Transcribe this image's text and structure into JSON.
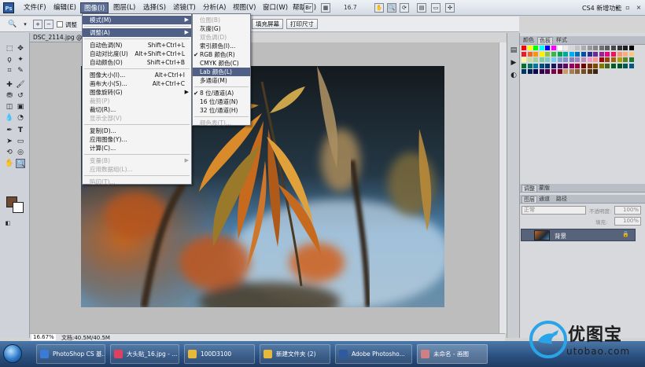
{
  "app": {
    "logo": "Ps",
    "zoom": "16.7",
    "workspace": "CS4 新增功能"
  },
  "menubar": [
    "文件(F)",
    "编辑(E)",
    "图像(I)",
    "图层(L)",
    "选择(S)",
    "滤镜(T)",
    "分析(A)",
    "视图(V)",
    "窗口(W)",
    "帮助(H)"
  ],
  "options_bar": {
    "resize_label": "调整",
    "print_size": "打印尺寸",
    "fill_screen": "填充屏幕"
  },
  "document": {
    "tab_title": "DSC_2114.jpg @",
    "zoom_percent": "16.67%",
    "doc_size": "文档:40.5M/40.5M"
  },
  "image_menu": [
    {
      "label": "模式(M)",
      "shortcut": "",
      "submenu": true,
      "disabled": false,
      "highlight": true
    },
    {
      "sep": true
    },
    {
      "label": "调整(A)",
      "shortcut": "",
      "submenu": true,
      "disabled": false,
      "highlight": false,
      "sub_hl": true
    },
    {
      "sep": true
    },
    {
      "label": "自动色调(N)",
      "shortcut": "Shift+Ctrl+L",
      "disabled": false
    },
    {
      "label": "自动对比度(U)",
      "shortcut": "Alt+Shift+Ctrl+L",
      "disabled": false
    },
    {
      "label": "自动颜色(O)",
      "shortcut": "Shift+Ctrl+B",
      "disabled": false
    },
    {
      "sep": true
    },
    {
      "label": "图像大小(I)...",
      "shortcut": "Alt+Ctrl+I",
      "disabled": false
    },
    {
      "label": "画布大小(S)...",
      "shortcut": "Alt+Ctrl+C",
      "disabled": false
    },
    {
      "label": "图像旋转(G)",
      "shortcut": "",
      "submenu": true,
      "disabled": false
    },
    {
      "label": "裁剪(P)",
      "shortcut": "",
      "disabled": true
    },
    {
      "label": "裁切(R)...",
      "shortcut": "",
      "disabled": false
    },
    {
      "label": "显示全部(V)",
      "shortcut": "",
      "disabled": true
    },
    {
      "sep": true
    },
    {
      "label": "复制(D)...",
      "shortcut": "",
      "disabled": false
    },
    {
      "label": "应用图像(Y)...",
      "shortcut": "",
      "disabled": false
    },
    {
      "label": "计算(C)...",
      "shortcut": "",
      "disabled": false
    },
    {
      "sep": true
    },
    {
      "label": "变量(B)",
      "shortcut": "",
      "submenu": true,
      "disabled": true
    },
    {
      "label": "应用数据组(L)...",
      "shortcut": "",
      "disabled": true
    },
    {
      "sep": true
    },
    {
      "label": "陷印(T)...",
      "shortcut": "",
      "disabled": true
    }
  ],
  "mode_menu": [
    {
      "label": "位图(B)",
      "disabled": true,
      "checked": false
    },
    {
      "label": "灰度(G)",
      "disabled": false,
      "checked": false
    },
    {
      "label": "双色调(D)",
      "disabled": true,
      "checked": false
    },
    {
      "label": "索引颜色(I)...",
      "disabled": false,
      "checked": false
    },
    {
      "label": "RGB 颜色(R)",
      "disabled": false,
      "checked": true
    },
    {
      "label": "CMYK 颜色(C)",
      "disabled": false,
      "checked": false
    },
    {
      "label": "Lab 颜色(L)",
      "disabled": false,
      "checked": false,
      "highlight": true
    },
    {
      "label": "多通道(M)",
      "disabled": false,
      "checked": false
    },
    {
      "sep": true
    },
    {
      "label": "8 位/通道(A)",
      "disabled": false,
      "checked": true
    },
    {
      "label": "16 位/通道(N)",
      "disabled": false,
      "checked": false
    },
    {
      "label": "32 位/通道(H)",
      "disabled": false,
      "checked": false
    },
    {
      "sep": true
    },
    {
      "label": "颜色表(T)...",
      "disabled": true,
      "checked": false
    }
  ],
  "panels": {
    "color_tabs": [
      "颜色",
      "色板",
      "样式"
    ],
    "adjust_tabs": [
      "调整",
      "蒙版"
    ],
    "layer_tabs": [
      "图层",
      "通道",
      "路径"
    ],
    "blend_mode": "正常",
    "opacity_label": "不透明度:",
    "opacity": "100%",
    "fill_label": "填充:",
    "fill": "100%",
    "layer_name": "背景"
  },
  "taskbar": [
    {
      "label": "PhotoShop CS 基...",
      "color": "#3a7bd5"
    },
    {
      "label": "大头贴_16.jpg - ...",
      "color": "#e04060"
    },
    {
      "label": "100D3100",
      "color": "#e8b83a"
    },
    {
      "label": "新建文件夹 (2)",
      "color": "#e8b83a"
    },
    {
      "label": "Adobe Photosho...",
      "color": "#2f5aa0"
    },
    {
      "label": "未命名 - 画图",
      "color": "#d08080"
    }
  ],
  "watermark": {
    "brand": "优图宝",
    "url": "utobao.com"
  }
}
